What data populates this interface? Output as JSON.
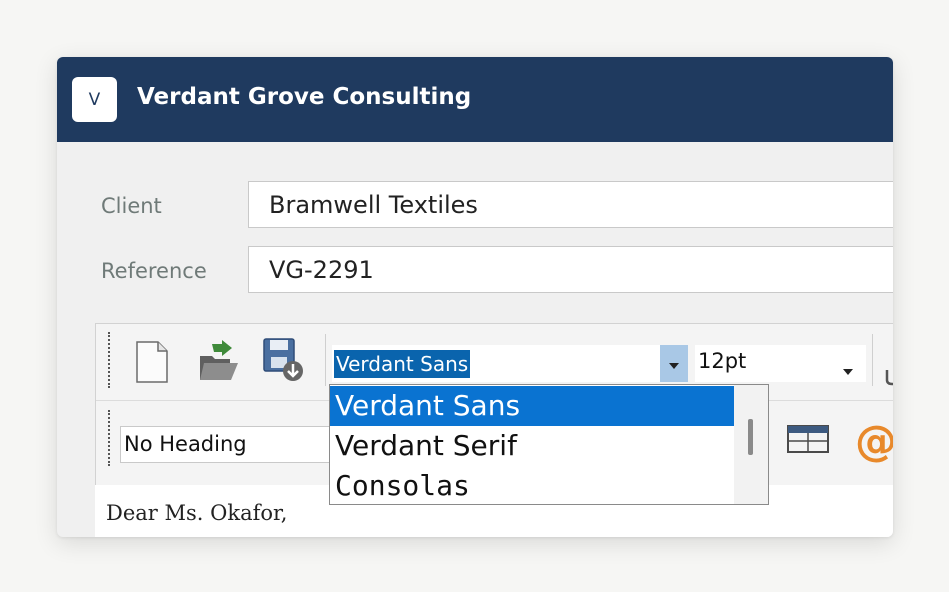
{
  "app": {
    "logo_letter": "V",
    "title": "Verdant Grove Consulting"
  },
  "form": {
    "client_label": "Client",
    "client_value": "Bramwell Textiles",
    "reference_label": "Reference",
    "reference_value": "VG-2291"
  },
  "toolbar": {
    "font_name": "Verdant Sans",
    "font_size": "12pt",
    "heading_style": "No Heading",
    "icons": [
      "new-document-icon",
      "open-folder-icon",
      "save-icon",
      "table-icon",
      "at-sign-icon"
    ]
  },
  "font_dropdown": {
    "options": [
      "Verdant Sans",
      "Verdant Serif",
      "Consolas"
    ],
    "selected_index": 0
  },
  "editor": {
    "first_line": "Dear Ms. Okafor,"
  },
  "colors": {
    "titlebar": "#1f3a5f",
    "selection": "#0a73d1",
    "accent_at": "#e8892b"
  }
}
